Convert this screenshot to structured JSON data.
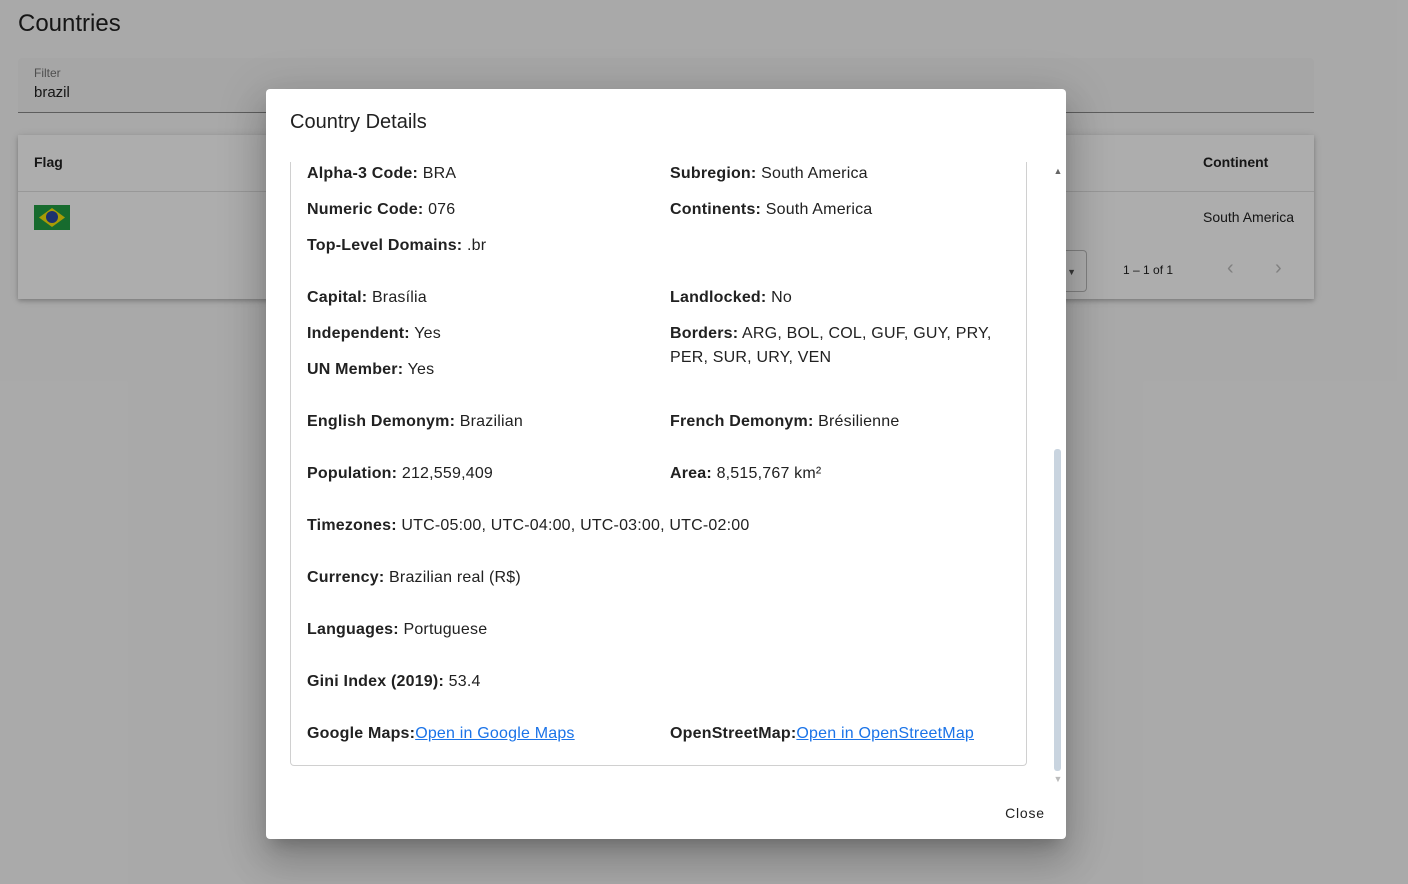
{
  "page": {
    "title": "Countries",
    "filter": {
      "label": "Filter",
      "value": "brazil"
    },
    "table": {
      "columns": {
        "flag": "Flag",
        "continent": "Continent"
      },
      "rows": [
        {
          "continent": "South America"
        }
      ],
      "paginator": {
        "range": "1 – 1 of 1"
      }
    }
  },
  "dialog": {
    "title": "Country Details",
    "fields": {
      "alpha3": {
        "label": "Alpha-3 Code:",
        "value": "BRA"
      },
      "subregion": {
        "label": "Subregion:",
        "value": "South America"
      },
      "numeric": {
        "label": "Numeric Code:",
        "value": "076"
      },
      "continents": {
        "label": "Continents:",
        "value": "South America"
      },
      "tld": {
        "label": "Top-Level Domains:",
        "value": ".br"
      },
      "capital": {
        "label": "Capital:",
        "value": "Brasília"
      },
      "landlocked": {
        "label": "Landlocked:",
        "value": "No"
      },
      "independent": {
        "label": "Independent:",
        "value": "Yes"
      },
      "borders": {
        "label": "Borders:",
        "value": "ARG, BOL, COL, GUF, GUY, PRY, PER, SUR, URY, VEN"
      },
      "un_member": {
        "label": "UN Member:",
        "value": "Yes"
      },
      "english_demonym": {
        "label": "English Demonym:",
        "value": "Brazilian"
      },
      "french_demonym": {
        "label": "French Demonym:",
        "value": "Brésilienne"
      },
      "population": {
        "label": "Population:",
        "value": "212,559,409"
      },
      "area": {
        "label": "Area:",
        "value": "8,515,767 km²"
      },
      "timezones": {
        "label": "Timezones:",
        "value": "UTC-05:00, UTC-04:00, UTC-03:00, UTC-02:00"
      },
      "currency": {
        "label": "Currency:",
        "value": "Brazilian real (R$)"
      },
      "languages": {
        "label": "Languages:",
        "value": "Portuguese"
      },
      "gini": {
        "label": "Gini Index (2019):",
        "value": "53.4"
      },
      "google_maps": {
        "label": "Google Maps:",
        "link": "Open in Google Maps"
      },
      "osm": {
        "label": "OpenStreetMap:",
        "link": "Open in OpenStreetMap"
      }
    },
    "close_label": "Close"
  },
  "colors": {
    "link": "#1a73e8",
    "backdrop": "rgba(0,0,0,0.32)"
  },
  "icons": {
    "prev": "chevron-left-icon",
    "next": "chevron-right-icon",
    "dropdown": "caret-down-icon"
  }
}
